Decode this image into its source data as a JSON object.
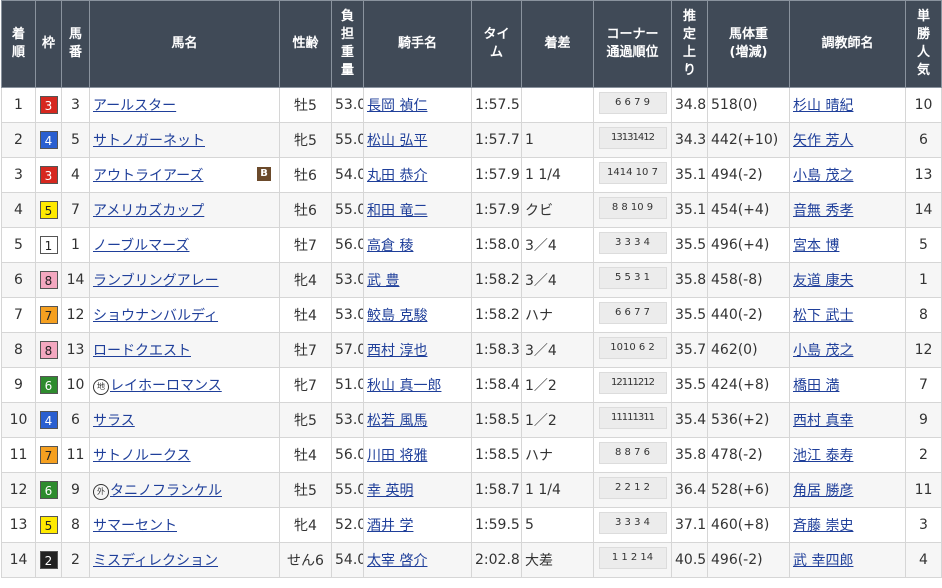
{
  "headers": {
    "rank": "着\n順",
    "waku": "枠",
    "umaban": "馬\n番",
    "horse": "馬名",
    "sexage": "性齢",
    "weight": "負\n担\n重\n量",
    "jockey": "騎手名",
    "time": "タイ\nム",
    "margin": "着差",
    "corner": "コーナー\n通過順位",
    "last3f": "推\n定\n上\nり",
    "bodyweight": "馬体重\n(増減)",
    "trainer": "調教師名",
    "popularity": "単\n勝\n人\n気"
  },
  "colors": {
    "header_bg": "#404a57",
    "link": "#1f3f9a",
    "waku_1": "#ffffff",
    "waku_2": "#222222",
    "waku_3": "#d6281f",
    "waku_4": "#2a5fd0",
    "waku_5": "#ffea00",
    "waku_6": "#2e8b2e",
    "waku_7": "#f5a020",
    "waku_8": "#f4a8c0"
  },
  "rows": [
    {
      "rank": "1",
      "waku": "3",
      "umaban": "3",
      "horse": "アールスター",
      "mark": "",
      "blinker": "",
      "sexage": "牡5",
      "weight": "53.0",
      "jockey": "長岡 禎仁",
      "time": "1:57.5",
      "margin": "",
      "corner": "6 6 7 9",
      "last3f": "34.8",
      "bodyweight": "518(0)",
      "trainer": "杉山 晴紀",
      "popularity": "10"
    },
    {
      "rank": "2",
      "waku": "4",
      "umaban": "5",
      "horse": "サトノガーネット",
      "mark": "",
      "blinker": "",
      "sexage": "牝5",
      "weight": "55.0",
      "jockey": "松山 弘平",
      "time": "1:57.7",
      "margin": "1",
      "corner": "13131412",
      "last3f": "34.3",
      "bodyweight": "442(+10)",
      "trainer": "矢作 芳人",
      "popularity": "6"
    },
    {
      "rank": "3",
      "waku": "3",
      "umaban": "4",
      "horse": "アウトライアーズ",
      "mark": "",
      "blinker": "B",
      "sexage": "牡6",
      "weight": "54.0",
      "jockey": "丸田 恭介",
      "time": "1:57.9",
      "margin": "1 1/4",
      "corner": "1414 10 7",
      "last3f": "35.1",
      "bodyweight": "494(-2)",
      "trainer": "小島 茂之",
      "popularity": "13"
    },
    {
      "rank": "4",
      "waku": "5",
      "umaban": "7",
      "horse": "アメリカズカップ",
      "mark": "",
      "blinker": "",
      "sexage": "牡6",
      "weight": "55.0",
      "jockey": "和田 竜二",
      "time": "1:57.9",
      "margin": "クビ",
      "corner": "8 8 10 9",
      "last3f": "35.1",
      "bodyweight": "454(+4)",
      "trainer": "音無 秀孝",
      "popularity": "14"
    },
    {
      "rank": "5",
      "waku": "1",
      "umaban": "1",
      "horse": "ノーブルマーズ",
      "mark": "",
      "blinker": "",
      "sexage": "牡7",
      "weight": "56.0",
      "jockey": "高倉 稜",
      "time": "1:58.0",
      "margin": "3／4",
      "corner": "3 3 3 4",
      "last3f": "35.5",
      "bodyweight": "496(+4)",
      "trainer": "宮本 博",
      "popularity": "5"
    },
    {
      "rank": "6",
      "waku": "8",
      "umaban": "14",
      "horse": "ランブリングアレー",
      "mark": "",
      "blinker": "",
      "sexage": "牝4",
      "weight": "53.0",
      "jockey": "武 豊",
      "time": "1:58.2",
      "margin": "3／4",
      "corner": "5 5 3 1",
      "last3f": "35.8",
      "bodyweight": "458(-8)",
      "trainer": "友道 康夫",
      "popularity": "1"
    },
    {
      "rank": "7",
      "waku": "7",
      "umaban": "12",
      "horse": "ショウナンバルディ",
      "mark": "",
      "blinker": "",
      "sexage": "牡4",
      "weight": "53.0",
      "jockey": "鮫島 克駿",
      "time": "1:58.2",
      "margin": "ハナ",
      "corner": "6 6 7 7",
      "last3f": "35.5",
      "bodyweight": "440(-2)",
      "trainer": "松下 武士",
      "popularity": "8"
    },
    {
      "rank": "8",
      "waku": "8",
      "umaban": "13",
      "horse": "ロードクエスト",
      "mark": "",
      "blinker": "",
      "sexage": "牡7",
      "weight": "57.0",
      "jockey": "西村 淳也",
      "time": "1:58.3",
      "margin": "3／4",
      "corner": "1010 6 2",
      "last3f": "35.7",
      "bodyweight": "462(0)",
      "trainer": "小島 茂之",
      "popularity": "12"
    },
    {
      "rank": "9",
      "waku": "6",
      "umaban": "10",
      "horse": "レイホーロマンス",
      "mark": "地",
      "blinker": "",
      "sexage": "牝7",
      "weight": "51.0",
      "jockey": "秋山 真一郎",
      "time": "1:58.4",
      "margin": "1／2",
      "corner": "12111212",
      "last3f": "35.5",
      "bodyweight": "424(+8)",
      "trainer": "橋田 満",
      "popularity": "7"
    },
    {
      "rank": "10",
      "waku": "4",
      "umaban": "6",
      "horse": "サラス",
      "mark": "",
      "blinker": "",
      "sexage": "牝5",
      "weight": "53.0",
      "jockey": "松若 風馬",
      "time": "1:58.5",
      "margin": "1／2",
      "corner": "11111311",
      "last3f": "35.4",
      "bodyweight": "536(+2)",
      "trainer": "西村 真幸",
      "popularity": "9"
    },
    {
      "rank": "11",
      "waku": "7",
      "umaban": "11",
      "horse": "サトノルークス",
      "mark": "",
      "blinker": "",
      "sexage": "牡4",
      "weight": "56.0",
      "jockey": "川田 将雅",
      "time": "1:58.5",
      "margin": "ハナ",
      "corner": "8 8 7 6",
      "last3f": "35.8",
      "bodyweight": "478(-2)",
      "trainer": "池江 泰寿",
      "popularity": "2"
    },
    {
      "rank": "12",
      "waku": "6",
      "umaban": "9",
      "horse": "タニノフランケル",
      "mark": "外",
      "blinker": "",
      "sexage": "牡5",
      "weight": "55.0",
      "jockey": "幸 英明",
      "time": "1:58.7",
      "margin": "1 1/4",
      "corner": "2 2 1 2",
      "last3f": "36.4",
      "bodyweight": "528(+6)",
      "trainer": "角居 勝彦",
      "popularity": "11"
    },
    {
      "rank": "13",
      "waku": "5",
      "umaban": "8",
      "horse": "サマーセント",
      "mark": "",
      "blinker": "",
      "sexage": "牝4",
      "weight": "52.0",
      "jockey": "酒井 学",
      "time": "1:59.5",
      "margin": "5",
      "corner": "3 3 3 4",
      "last3f": "37.1",
      "bodyweight": "460(+8)",
      "trainer": "斉藤 崇史",
      "popularity": "3"
    },
    {
      "rank": "14",
      "waku": "2",
      "umaban": "2",
      "horse": "ミスディレクション",
      "mark": "",
      "blinker": "",
      "sexage": "せん6",
      "weight": "54.0",
      "jockey": "太宰 啓介",
      "time": "2:02.8",
      "margin": "大差",
      "corner": "1 1 2 14",
      "last3f": "40.5",
      "bodyweight": "496(-2)",
      "trainer": "武 幸四郎",
      "popularity": "4"
    }
  ]
}
